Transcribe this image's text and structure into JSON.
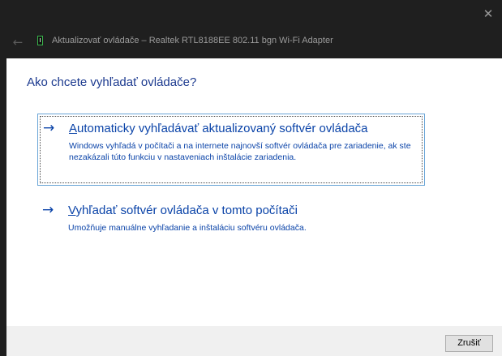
{
  "window": {
    "title": "Aktualizovať ovládače – Realtek RTL8188EE 802.11 bgn Wi-Fi Adapter",
    "close_glyph": "✕",
    "back_glyph": "←",
    "icon": "network-adapter-icon"
  },
  "main": {
    "heading": "Ako chcete vyhľadať ovládače?",
    "options": [
      {
        "arrow": "→",
        "title_accesskey": "A",
        "title_rest": "utomaticky vyhľadávať aktualizovaný softvér ovládača",
        "description": "Windows vyhľadá v počítači a na internete najnovší softvér ovládača pre zariadenie, ak ste nezakázali túto funkciu v nastaveniach inštalácie zariadenia.",
        "focused": true
      },
      {
        "arrow": "→",
        "title_accesskey": "V",
        "title_rest": "yhľadať softvér ovládača v tomto počítači",
        "description": "Umožňuje manuálne vyhľadanie a inštaláciu softvéru ovládača.",
        "focused": false
      }
    ]
  },
  "footer": {
    "cancel_label": "Zrušiť"
  },
  "colors": {
    "title_bar": "#1f1f1f",
    "link_blue": "#0a43a8",
    "heading_blue": "#1c3a8f",
    "focus_border": "#69a4d6",
    "footer_bg": "#f0f0f0"
  }
}
